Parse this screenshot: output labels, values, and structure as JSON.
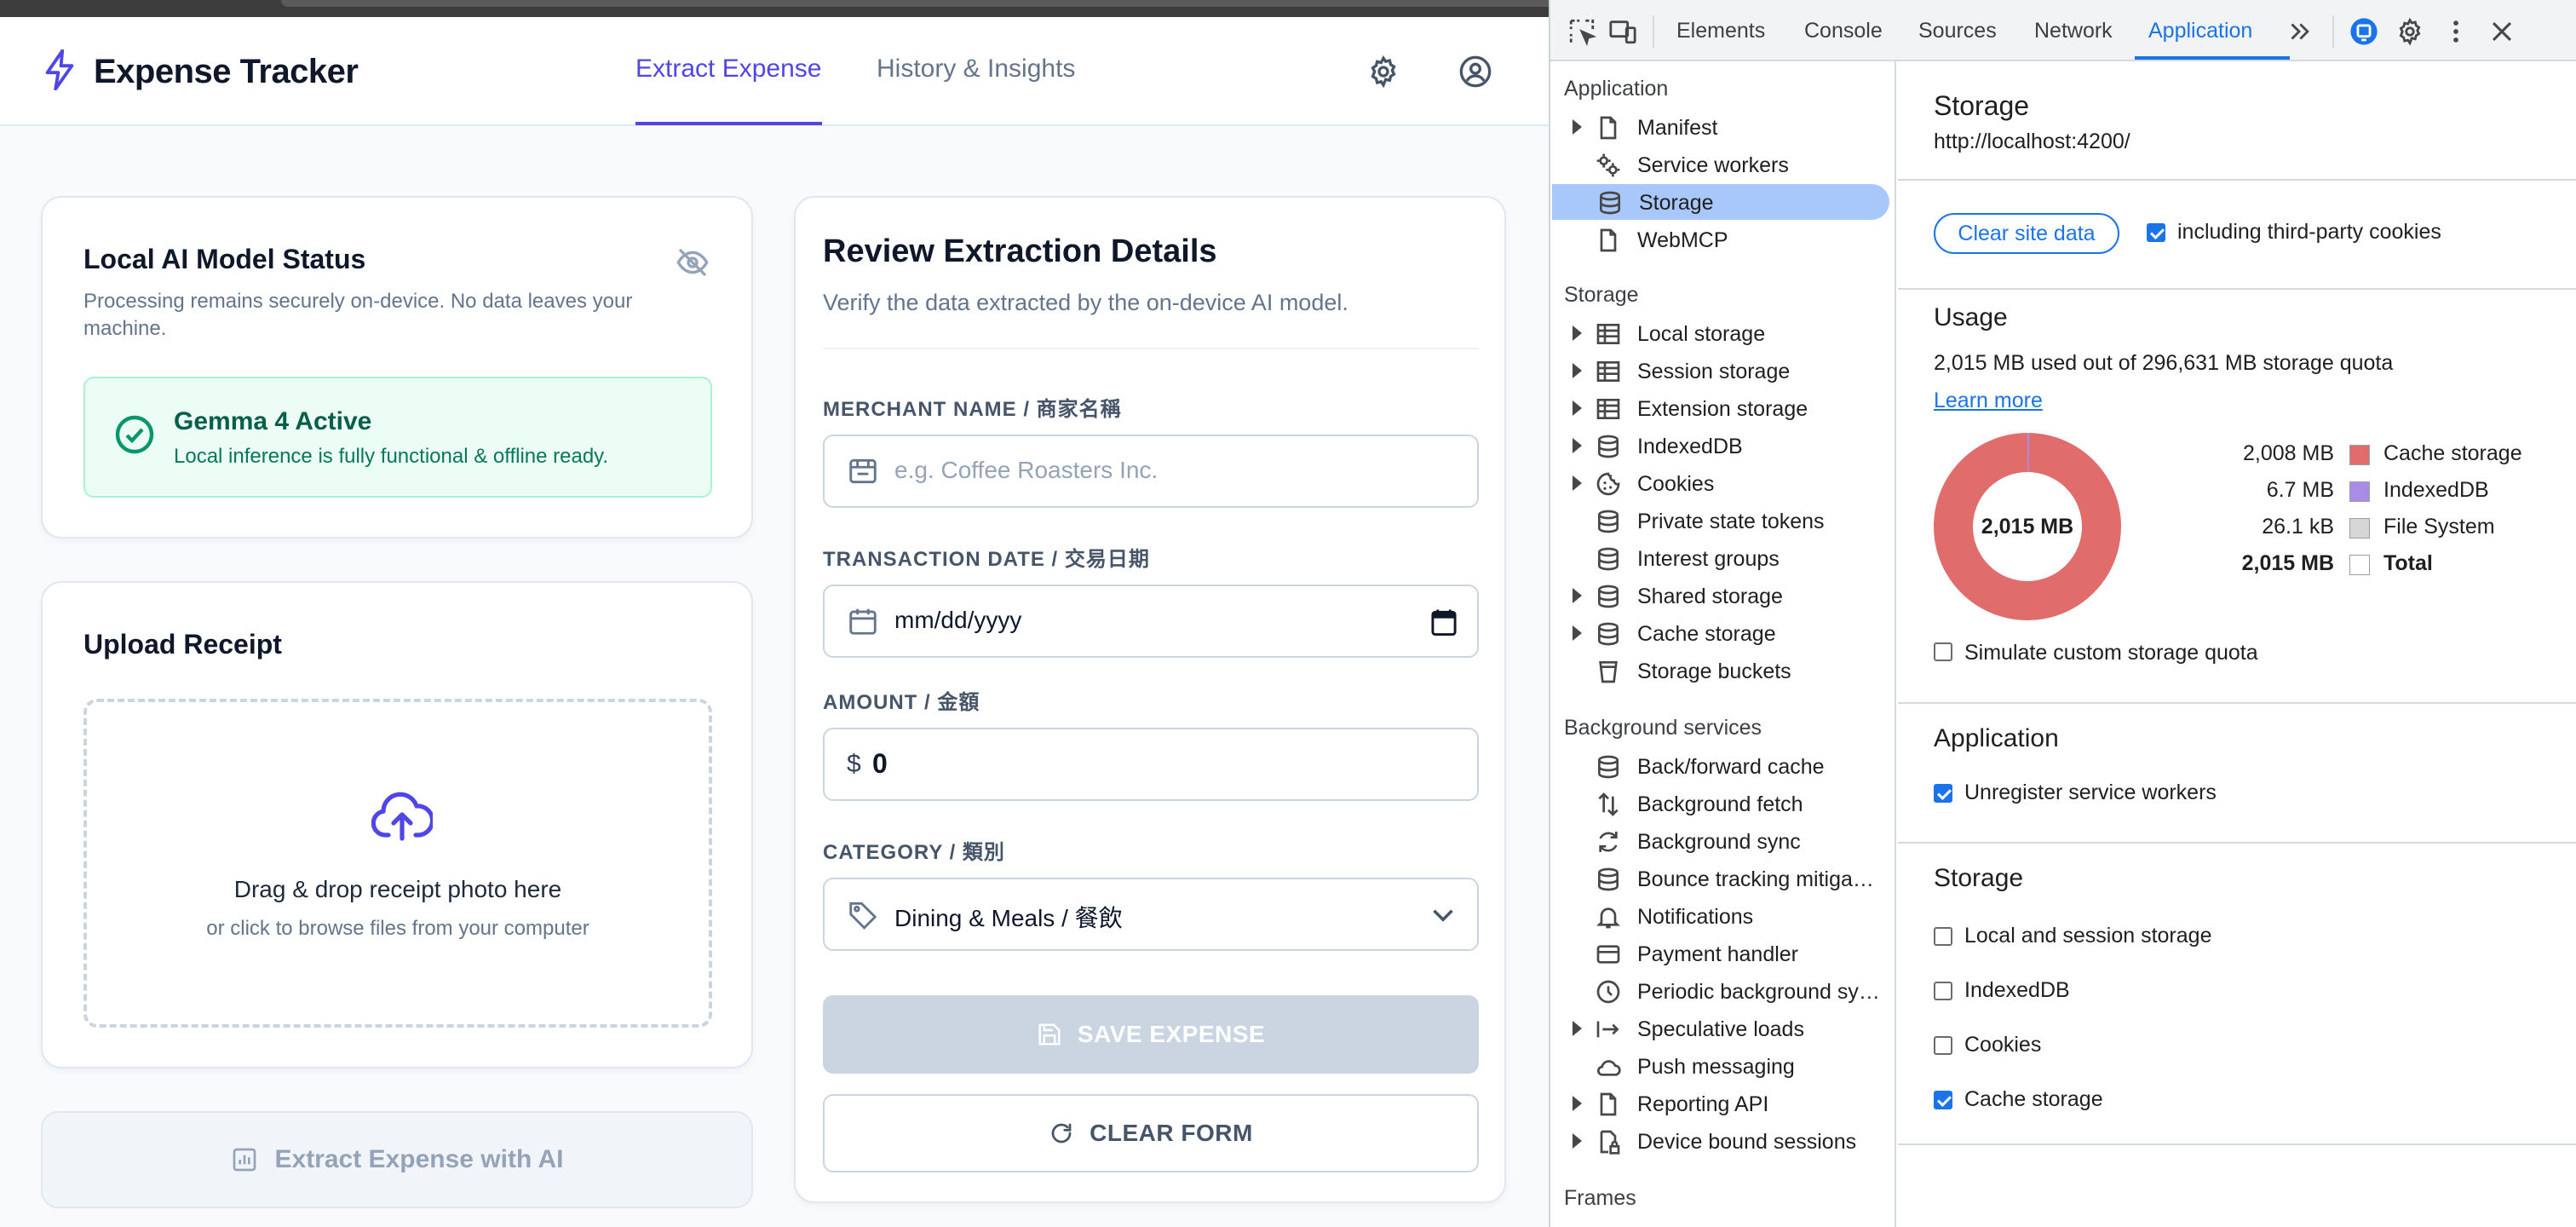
{
  "app": {
    "brand": "Expense Tracker",
    "tabs": [
      {
        "label": "Extract Expense",
        "active": true
      },
      {
        "label": "History & Insights",
        "active": false
      }
    ],
    "model_status": {
      "title": "Local AI Model Status",
      "description": "Processing remains securely on-device. No data leaves your machine.",
      "badge_title": "Gemma 4 Active",
      "badge_text": "Local inference is fully functional & offline ready."
    },
    "upload": {
      "title": "Upload Receipt",
      "drop_text": "Drag & drop receipt photo here",
      "browse_text": "or click to browse files from your computer"
    },
    "extract_button": "Extract Expense with AI",
    "review": {
      "title": "Review Extraction Details",
      "subtitle": "Verify the data extracted by the on-device AI model.",
      "merchant_label": "MERCHANT NAME / 商家名稱",
      "merchant_placeholder": "e.g. Coffee Roasters Inc.",
      "date_label": "TRANSACTION DATE / 交易日期",
      "date_placeholder": "mm/dd/yyyy",
      "amount_label": "AMOUNT / 金額",
      "currency_symbol": "$",
      "amount_value": "0",
      "category_label": "CATEGORY / 類別",
      "category_value": "Dining & Meals / 餐飲",
      "save_button": "SAVE EXPENSE",
      "clear_button": "CLEAR FORM"
    },
    "colors": {
      "accent": "#4f46e5",
      "success_bg": "#ecfdf5",
      "success_text": "#065f46",
      "disabled": "#cbd5e1"
    }
  },
  "devtools": {
    "tabs": [
      "Elements",
      "Console",
      "Sources",
      "Network",
      "Application"
    ],
    "active_tab": "Application",
    "sidebar": {
      "application_heading": "Application",
      "application_items": [
        {
          "label": "Manifest",
          "icon": "file-icon",
          "expandable": true
        },
        {
          "label": "Service workers",
          "icon": "gears-icon",
          "expandable": false
        },
        {
          "label": "Storage",
          "icon": "database-icon",
          "expandable": false,
          "selected": true
        },
        {
          "label": "WebMCP",
          "icon": "file-icon",
          "expandable": false
        }
      ],
      "storage_heading": "Storage",
      "storage_items": [
        {
          "label": "Local storage",
          "icon": "table-icon",
          "expandable": true
        },
        {
          "label": "Session storage",
          "icon": "table-icon",
          "expandable": true
        },
        {
          "label": "Extension storage",
          "icon": "table-icon",
          "expandable": true
        },
        {
          "label": "IndexedDB",
          "icon": "database-icon",
          "expandable": true
        },
        {
          "label": "Cookies",
          "icon": "cookie-icon",
          "expandable": true
        },
        {
          "label": "Private state tokens",
          "icon": "database-icon",
          "expandable": false
        },
        {
          "label": "Interest groups",
          "icon": "database-icon",
          "expandable": false
        },
        {
          "label": "Shared storage",
          "icon": "database-icon",
          "expandable": true
        },
        {
          "label": "Cache storage",
          "icon": "database-icon",
          "expandable": true
        },
        {
          "label": "Storage buckets",
          "icon": "bucket-icon",
          "expandable": false
        }
      ],
      "background_heading": "Background services",
      "background_items": [
        {
          "label": "Back/forward cache",
          "icon": "database-icon",
          "expandable": false
        },
        {
          "label": "Background fetch",
          "icon": "arrows-updown-icon",
          "expandable": false
        },
        {
          "label": "Background sync",
          "icon": "sync-icon",
          "expandable": false
        },
        {
          "label": "Bounce tracking mitiga…",
          "icon": "database-icon",
          "expandable": false
        },
        {
          "label": "Notifications",
          "icon": "bell-icon",
          "expandable": false
        },
        {
          "label": "Payment handler",
          "icon": "card-icon",
          "expandable": false
        },
        {
          "label": "Periodic background sy…",
          "icon": "clock-icon",
          "expandable": false
        },
        {
          "label": "Speculative loads",
          "icon": "arrow-bar-icon",
          "expandable": true
        },
        {
          "label": "Push messaging",
          "icon": "cloud-icon",
          "expandable": false
        },
        {
          "label": "Reporting API",
          "icon": "file-icon",
          "expandable": true
        },
        {
          "label": "Device bound sessions",
          "icon": "lock-file-icon",
          "expandable": true
        }
      ],
      "frames_heading": "Frames"
    },
    "main": {
      "title": "Storage",
      "origin": "http://localhost:4200/",
      "clear_button": "Clear site data",
      "third_party_label": "including third-party cookies",
      "third_party_checked": true,
      "usage_heading": "Usage",
      "usage_text": "2,015 MB used out of 296,631 MB storage quota",
      "learn_more": "Learn more",
      "donut_center": "2,015 MB",
      "legend": [
        {
          "value": "2,008 MB",
          "name": "Cache storage",
          "color": "#e06c6c",
          "bold": false
        },
        {
          "value": "6.7 MB",
          "name": "IndexedDB",
          "color": "#a98ce6",
          "bold": false
        },
        {
          "value": "26.1 kB",
          "name": "File System",
          "color": "#d6d6d6",
          "bold": false
        },
        {
          "value": "2,015 MB",
          "name": "Total",
          "color": "#ffffff",
          "bold": true
        }
      ],
      "simulate_label": "Simulate custom storage quota",
      "simulate_checked": false,
      "application_heading": "Application",
      "unregister_label": "Unregister service workers",
      "unregister_checked": true,
      "storage_heading": "Storage",
      "storage_checks": [
        {
          "label": "Local and session storage",
          "checked": false
        },
        {
          "label": "IndexedDB",
          "checked": false
        },
        {
          "label": "Cookies",
          "checked": false
        },
        {
          "label": "Cache storage",
          "checked": true
        }
      ]
    }
  }
}
